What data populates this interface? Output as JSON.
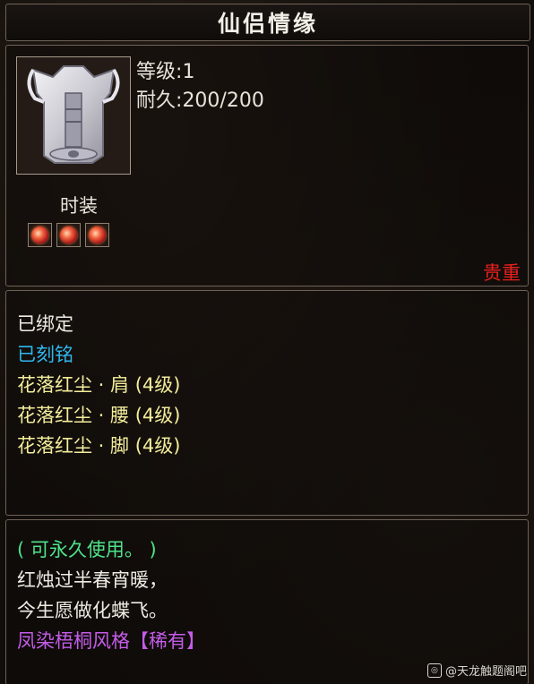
{
  "title": "仙侣情缘",
  "item": {
    "icon": "white-armor-vest-icon",
    "stats": [
      {
        "label": "等级",
        "value": "1"
      },
      {
        "label": "耐久",
        "value": "200/200"
      }
    ],
    "slot": "时装",
    "gems": [
      "red-gem-icon",
      "red-gem-icon",
      "red-gem-icon"
    ],
    "rarity": "贵重",
    "rarity_color": "#e8201d"
  },
  "properties": {
    "bound": "已绑定",
    "engraved": "已刻铭",
    "engraved_color": "#2fb7ee",
    "set_parts": [
      "花落红尘 · 肩 (4级)",
      "花落红尘 · 腰 (4级)",
      "花落红尘 · 脚 (4级)"
    ],
    "set_color": "#f4ee9c"
  },
  "description": {
    "usage": "( 可永久使用。 )",
    "usage_color": "#4ee38a",
    "lines": [
      "红烛过半春宵暖，",
      "今生愿做化蝶飞。"
    ],
    "style_tag": "凤染梧桐风格【稀有】",
    "style_color": "#c45ce8"
  },
  "watermark": "@天龙触题阁吧"
}
